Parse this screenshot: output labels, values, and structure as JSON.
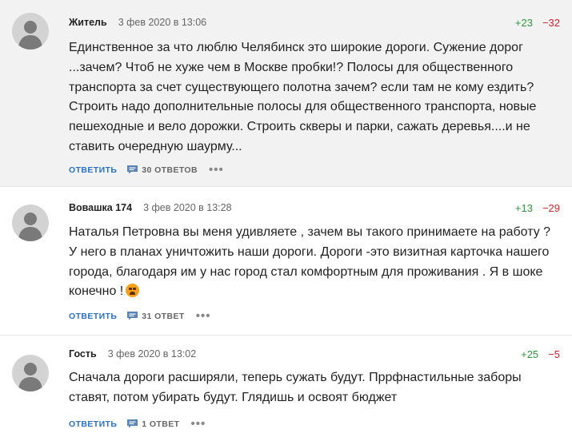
{
  "comments": [
    {
      "author": "Житель",
      "date": "3 фев 2020 в 13:06",
      "votes_up": "+23",
      "votes_down": "−32",
      "text": "Единственное за что люблю Челябинск это широкие дороги. Сужение дорог ...зачем? Чтоб не хуже чем в Москве пробки!? Полосы для общественного транспорта за счет существующего полотна зачем? если там не кому ездить? Строить надо дополнительные полосы для общественного транспорта, новые пешеходные и вело дорожки. Строить скверы и парки, сажать деревья....и не ставить очередную шаурму...",
      "reply_label": "ОТВЕТИТЬ",
      "replies_label": "30 ОТВЕТОВ",
      "more_label": "•••"
    },
    {
      "author": "Вовашка 174",
      "date": "3 фев 2020 в 13:28",
      "votes_up": "+13",
      "votes_down": "−29",
      "text": "Наталья Петровна вы меня удивляете , зачем вы такого принимаете на работу ? У него в планах уничтожить наши дороги. Дороги -это визитная карточка нашего города, благодаря им у нас город стал комфортным для проживания . Я в шоке конечно !",
      "emoji": "anguished-face",
      "reply_label": "ОТВЕТИТЬ",
      "replies_label": "31 ОТВЕТ",
      "more_label": "•••"
    },
    {
      "author": "Гость",
      "date": "3 фев 2020 в 13:02",
      "votes_up": "+25",
      "votes_down": "−5",
      "text": "Сначала дороги расширяли, теперь сужать будут. Пррфнастильные заборы ставят, потом убирать будут. Глядишь и освоят бюджет",
      "reply_label": "ОТВЕТИТЬ",
      "replies_label": "1 ОТВЕТ",
      "more_label": "•••"
    }
  ],
  "colors": {
    "reply_link": "#2a72c5",
    "vote_up": "#2b9a3a",
    "vote_down": "#d2232a",
    "highlight_bg": "#f2f2f2"
  },
  "icons": {
    "avatar": "user-silhouette-icon",
    "replies": "chat-bubble-icon",
    "more": "ellipsis-icon"
  }
}
